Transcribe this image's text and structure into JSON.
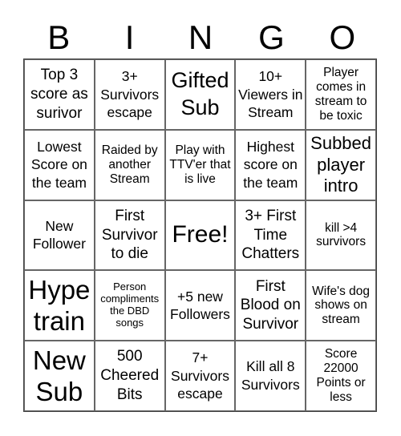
{
  "header": {
    "letters": [
      "B",
      "I",
      "N",
      "G",
      "O"
    ]
  },
  "grid": {
    "rows": [
      [
        "Top 3 score as surivor",
        "3+ Survivors escape",
        "Gifted Sub",
        "10+ Viewers in Stream",
        "Player comes in stream to be toxic"
      ],
      [
        "Lowest Score on the team",
        "Raided by another Stream",
        "Play with TTV'er that is live",
        "Highest score on the team",
        "Subbed player intro"
      ],
      [
        "New Follower",
        "First Survivor to die",
        "Free!",
        "3+ First Time Chatters",
        "kill >4 survivors"
      ],
      [
        "Hype train",
        "Person compliments the DBD songs",
        "+5 new Followers",
        "First Blood on Survivor",
        "Wife's dog shows on stream"
      ],
      [
        "New Sub",
        "500 Cheered Bits",
        "7+ Survivors escape",
        "Kill all 8 Survivors",
        "Score 22000 Points or less"
      ]
    ]
  }
}
